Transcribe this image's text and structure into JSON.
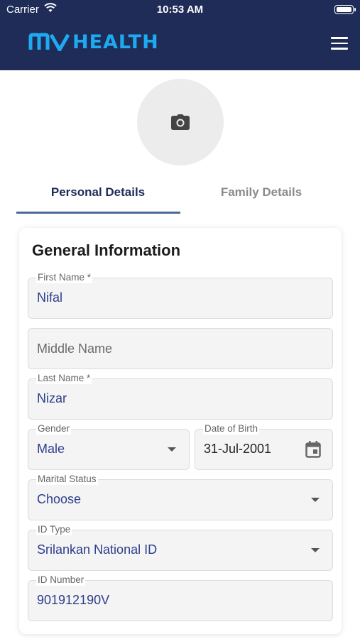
{
  "status_bar": {
    "carrier": "Carrier",
    "time": "10:53 AM"
  },
  "app_bar": {
    "logo_text": "HEALTH",
    "colors": {
      "background": "#1f2c57",
      "logo": "#1eaaf1"
    }
  },
  "tabs": [
    {
      "label": "Personal Details",
      "active": true
    },
    {
      "label": "Family Details",
      "active": false
    }
  ],
  "card": {
    "title": "General Information",
    "fields": {
      "first_name": {
        "label": "First Name *",
        "value": "Nifal"
      },
      "middle_name": {
        "placeholder": "Middle Name"
      },
      "last_name": {
        "label": "Last Name *",
        "value": "Nizar"
      },
      "gender": {
        "label": "Gender",
        "value": "Male"
      },
      "dob": {
        "label": "Date of Birth",
        "value": "31-Jul-2001"
      },
      "marital_status": {
        "label": "Marital Status",
        "value": "Choose"
      },
      "id_type": {
        "label": "ID Type",
        "value": "Srilankan National ID"
      },
      "id_number": {
        "label": "ID Number",
        "value": "901912190V"
      }
    }
  }
}
